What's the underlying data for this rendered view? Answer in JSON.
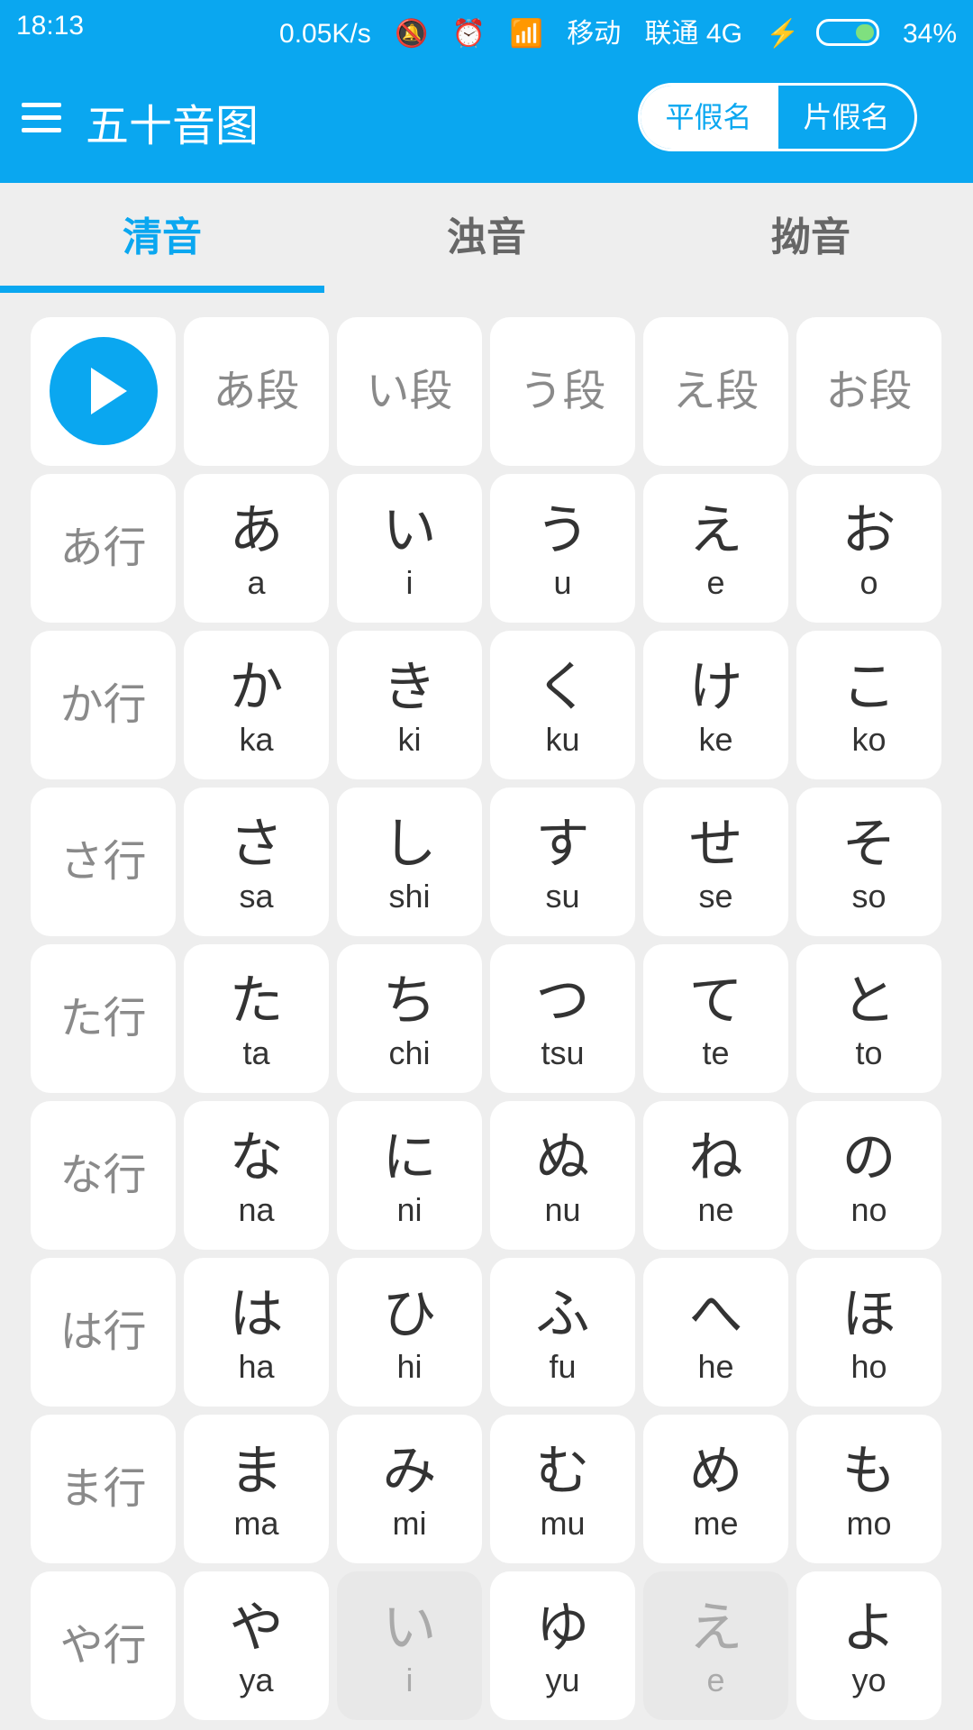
{
  "status": {
    "time": "18:13",
    "speed": "0.05K/s",
    "carrier1": "移动",
    "carrier2": "联通 4G",
    "battery": "34%"
  },
  "header": {
    "title": "五十音图",
    "toggle": {
      "hiragana": "平假名",
      "katakana": "片假名"
    }
  },
  "tabs": [
    {
      "label": "清音"
    },
    {
      "label": "浊音"
    },
    {
      "label": "拗音"
    }
  ],
  "columns": [
    "あ段",
    "い段",
    "う段",
    "え段",
    "お段"
  ],
  "rows": [
    {
      "label": "あ行",
      "cells": [
        [
          "あ",
          "a"
        ],
        [
          "い",
          "i"
        ],
        [
          "う",
          "u"
        ],
        [
          "え",
          "e"
        ],
        [
          "お",
          "o"
        ]
      ]
    },
    {
      "label": "か行",
      "cells": [
        [
          "か",
          "ka"
        ],
        [
          "き",
          "ki"
        ],
        [
          "く",
          "ku"
        ],
        [
          "け",
          "ke"
        ],
        [
          "こ",
          "ko"
        ]
      ]
    },
    {
      "label": "さ行",
      "cells": [
        [
          "さ",
          "sa"
        ],
        [
          "し",
          "shi"
        ],
        [
          "す",
          "su"
        ],
        [
          "せ",
          "se"
        ],
        [
          "そ",
          "so"
        ]
      ]
    },
    {
      "label": "た行",
      "cells": [
        [
          "た",
          "ta"
        ],
        [
          "ち",
          "chi"
        ],
        [
          "つ",
          "tsu"
        ],
        [
          "て",
          "te"
        ],
        [
          "と",
          "to"
        ]
      ]
    },
    {
      "label": "な行",
      "cells": [
        [
          "な",
          "na"
        ],
        [
          "に",
          "ni"
        ],
        [
          "ぬ",
          "nu"
        ],
        [
          "ね",
          "ne"
        ],
        [
          "の",
          "no"
        ]
      ]
    },
    {
      "label": "は行",
      "cells": [
        [
          "は",
          "ha"
        ],
        [
          "ひ",
          "hi"
        ],
        [
          "ふ",
          "fu"
        ],
        [
          "へ",
          "he"
        ],
        [
          "ほ",
          "ho"
        ]
      ]
    },
    {
      "label": "ま行",
      "cells": [
        [
          "ま",
          "ma"
        ],
        [
          "み",
          "mi"
        ],
        [
          "む",
          "mu"
        ],
        [
          "め",
          "me"
        ],
        [
          "も",
          "mo"
        ]
      ]
    },
    {
      "label": "や行",
      "cells": [
        [
          "や",
          "ya"
        ],
        [
          "い",
          "i"
        ],
        [
          "ゆ",
          "yu"
        ],
        [
          "え",
          "e"
        ],
        [
          "よ",
          "yo"
        ]
      ]
    }
  ]
}
